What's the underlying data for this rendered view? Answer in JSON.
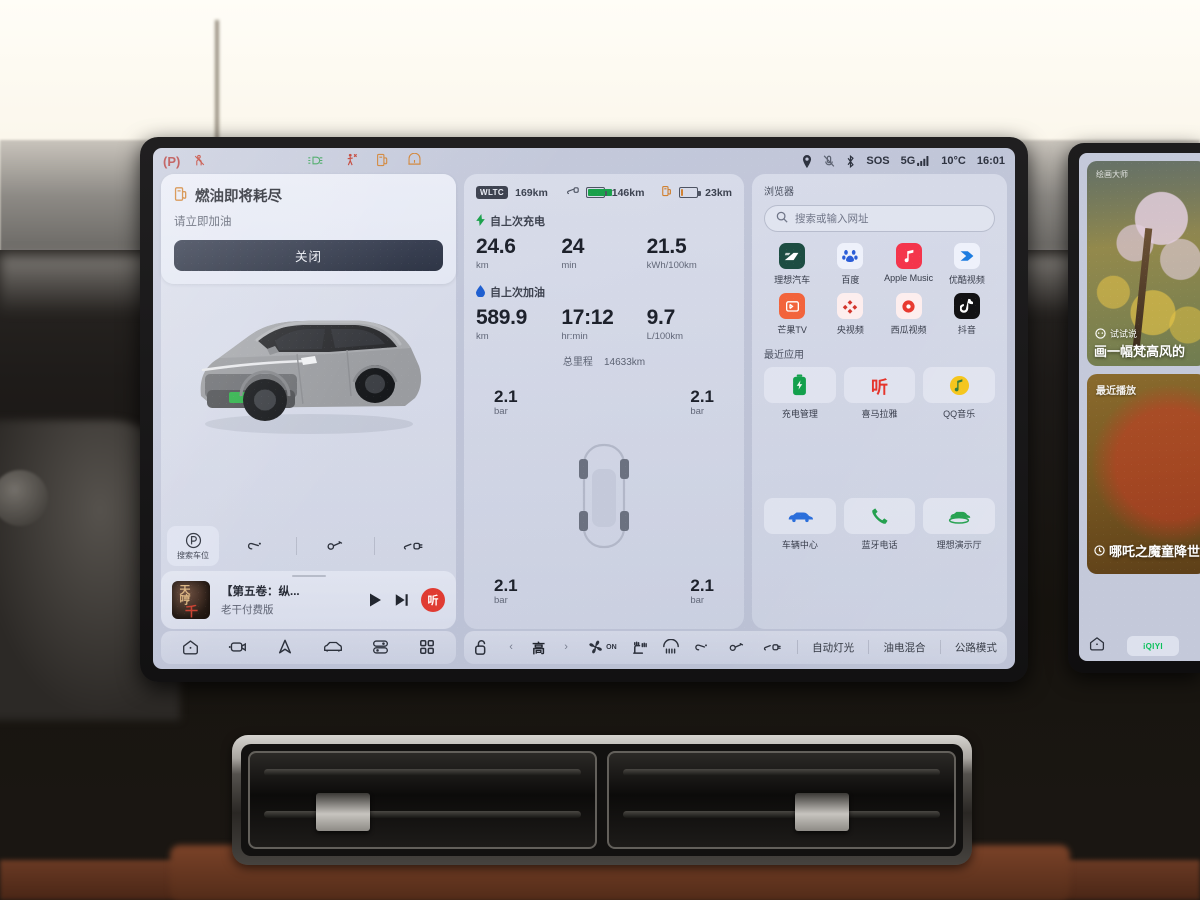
{
  "warning_icons": [
    {
      "name": "parking-brake-warning-icon",
      "glyph": "(P)",
      "color": "#b33a3a"
    },
    {
      "name": "seatbelt-warning-icon",
      "glyph": "seatbelt",
      "color": "#c0392b"
    },
    {
      "name": "headlight-on-icon",
      "glyph": "headlight",
      "color": "#3aa25a"
    },
    {
      "name": "pedestrian-warning-icon",
      "glyph": "pedestrian",
      "color": "#c0392b"
    },
    {
      "name": "low-fuel-warning-icon",
      "glyph": "fuel-pump",
      "color": "#d08030"
    },
    {
      "name": "tire-pressure-warning-icon",
      "glyph": "tpms",
      "color": "#d08030"
    }
  ],
  "status_bar": {
    "location_icon": "location-pin-icon",
    "mic_muted_icon": "microphone-muted-icon",
    "bluetooth_icon": "bluetooth-icon",
    "sos_label": "SOS",
    "network_label": "5G",
    "temperature": "10°C",
    "time": "16:01"
  },
  "alert": {
    "icon": "fuel-pump-icon",
    "title": "燃油即将耗尽",
    "subtitle": "请立即加油",
    "button_label": "关闭"
  },
  "vehicle": {
    "model_color": "#9a9ca0",
    "plate_color": "#2fb24a"
  },
  "quick_actions": {
    "park_button": {
      "icon": "parking-p-icon",
      "label": "搜索车位"
    },
    "icons": [
      "fuel-flap-icon",
      "charge-port-icon",
      "charge-cable-icon"
    ]
  },
  "media": {
    "title": "【第五卷：纵...",
    "artist": "老干付费版",
    "play_icon": "play-icon",
    "next_icon": "next-track-icon",
    "app_badge": "听"
  },
  "trip": {
    "range": {
      "wltc_chip": "WLTC",
      "wltc_value": "169km",
      "electric_icon": "battery-icon",
      "electric_value": "146km",
      "electric_color": "#19a04a",
      "fuel_icon": "fuel-icon",
      "fuel_value": "23km",
      "fuel_color": "#d08030"
    },
    "since_charge": {
      "icon": "lightning-bolt-icon",
      "label": "自上次充电",
      "stats": [
        {
          "value": "24.6",
          "unit": "km"
        },
        {
          "value": "24",
          "unit": "min"
        },
        {
          "value": "21.5",
          "unit": "kWh/100km"
        }
      ]
    },
    "since_refuel": {
      "icon": "fuel-drop-icon",
      "label": "自上次加油",
      "stats": [
        {
          "value": "589.9",
          "unit": "km"
        },
        {
          "value": "17:12",
          "unit": "hr:min"
        },
        {
          "value": "9.7",
          "unit": "L/100km"
        }
      ]
    },
    "odometer_label": "总里程",
    "odometer_value": "14633km"
  },
  "tires": {
    "unit": "bar",
    "front_left": "2.1",
    "front_right": "2.1",
    "rear_left": "2.1",
    "rear_right": "2.1"
  },
  "browser": {
    "label": "浏览器",
    "search_placeholder": "搜索或输入网址",
    "search_icon": "search-icon",
    "bookmarks": [
      {
        "label": "理想汽车",
        "icon": "li-auto-icon",
        "bg": "#1d4d42",
        "fg": "#ffffff"
      },
      {
        "label": "百度",
        "icon": "baidu-icon",
        "bg": "#eef1fb",
        "fg": "#2a5cd7"
      },
      {
        "label": "Apple Music",
        "icon": "apple-music-icon",
        "bg": "#f4354c",
        "fg": "#ffffff"
      },
      {
        "label": "优酷视频",
        "icon": "youku-icon",
        "bg": "#eef1fb",
        "fg": "#1a7ae0"
      },
      {
        "label": "芒果TV",
        "icon": "mango-tv-icon",
        "bg": "#f2643c",
        "fg": "#ffffff"
      },
      {
        "label": "央视频",
        "icon": "cctv-video-icon",
        "bg": "#fdeeee",
        "fg": "#d3352c"
      },
      {
        "label": "西瓜视频",
        "icon": "xigua-video-icon",
        "bg": "#fdeeee",
        "fg": "#e8392f"
      },
      {
        "label": "抖音",
        "icon": "douyin-icon",
        "bg": "#0e0e10",
        "fg": "#ffffff"
      }
    ],
    "recent_label": "最近应用",
    "recent_apps": [
      {
        "label": "充电管理",
        "icon": "battery-charging-icon",
        "color": "#13a04c"
      },
      {
        "label": "喜马拉雅",
        "icon": "ximalaya-icon",
        "color": "#e5332a"
      },
      {
        "label": "QQ音乐",
        "icon": "qq-music-icon",
        "color": "#f5c518"
      },
      {
        "label": "车辆中心",
        "icon": "vehicle-center-icon",
        "color": "#2a6edb"
      },
      {
        "label": "蓝牙电话",
        "icon": "phone-call-icon",
        "color": "#1f9e4b"
      },
      {
        "label": "理想演示厅",
        "icon": "showroom-icon",
        "color": "#1f9e4b"
      }
    ]
  },
  "bottom_bar": {
    "nav_icons": [
      {
        "name": "home-icon"
      },
      {
        "name": "dashcam-icon"
      },
      {
        "name": "navigation-icon"
      },
      {
        "name": "vehicle-icon"
      },
      {
        "name": "settings-sliders-icon"
      },
      {
        "name": "apps-grid-icon"
      }
    ],
    "unlock_icon": "unlock-icon",
    "fan_level": "高",
    "prev_icon": "chevron-left-icon",
    "next_icon": "chevron-right-icon",
    "fan_state": "ON",
    "climate_icons": [
      {
        "name": "fan-icon"
      },
      {
        "name": "seat-heater-icon"
      },
      {
        "name": "defrost-rear-icon"
      },
      {
        "name": "fuel-flap-icon"
      },
      {
        "name": "charge-port-icon"
      },
      {
        "name": "charge-cable-icon"
      }
    ],
    "text_buttons": [
      "自动灯光",
      "油电混合",
      "公路模式"
    ]
  },
  "passenger_screen": {
    "card1": {
      "badge": "绘画大师",
      "prompt_icon": "speech-bubble-icon",
      "prompt_label": "试试说",
      "prompt_text": "画一幅梵高风的"
    },
    "card2": {
      "title": "最近播放",
      "clock_icon": "clock-icon",
      "item": "哪吒之魔童降世"
    },
    "home_icon": "home-icon",
    "app_badge": "iQIYI"
  }
}
